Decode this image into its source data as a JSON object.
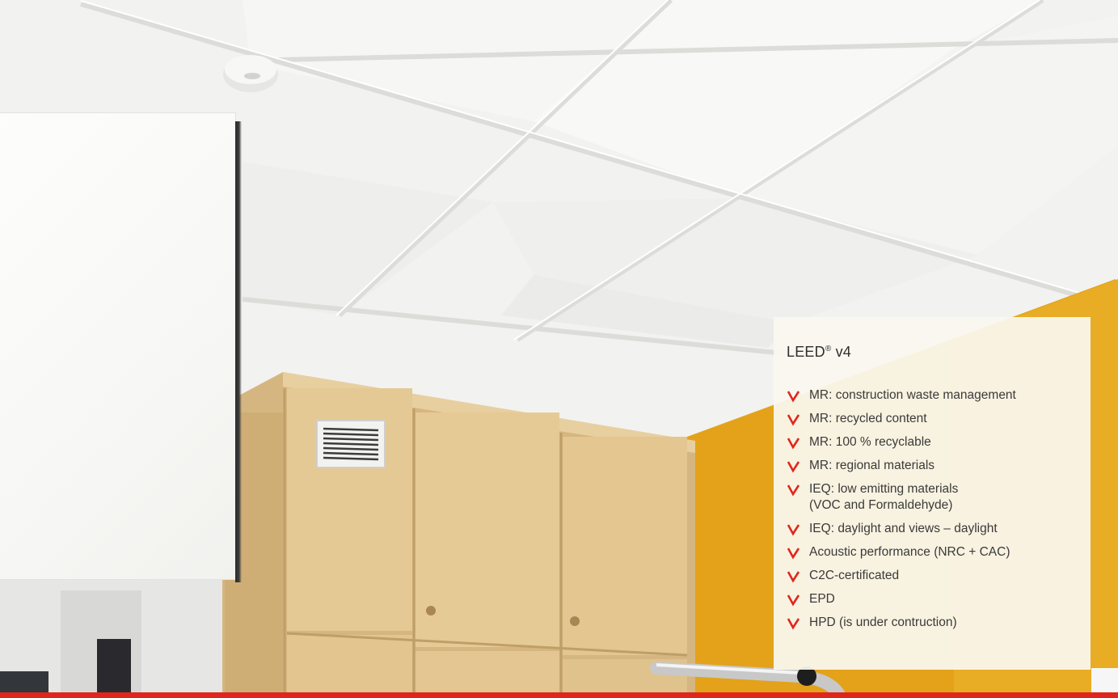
{
  "panel": {
    "title_main": "LEED",
    "title_mark": "®",
    "title_version": " v4",
    "items": [
      {
        "line1": "MR: construction waste management"
      },
      {
        "line1": "MR: recycled content"
      },
      {
        "line1": "MR: 100 % recyclable"
      },
      {
        "line1": "MR: regional materials"
      },
      {
        "line1": "IEQ: low emitting materials",
        "line2": "(VOC and Formaldehyde)"
      },
      {
        "line1": "IEQ: daylight and views – daylight"
      },
      {
        "line1": "Acoustic performance (NRC + CAC)"
      },
      {
        "line1": "C2C-certificated"
      },
      {
        "line1": "EPD"
      },
      {
        "line1": "HPD (is under contruction)"
      }
    ],
    "bullet_icon": "red-arrow-icon"
  },
  "colors": {
    "accent": "#e0261c",
    "wall": "#e3a21a",
    "cabinet": "#e2c593",
    "ceiling": "#f1f1ef",
    "text": "#3a3a3a"
  }
}
